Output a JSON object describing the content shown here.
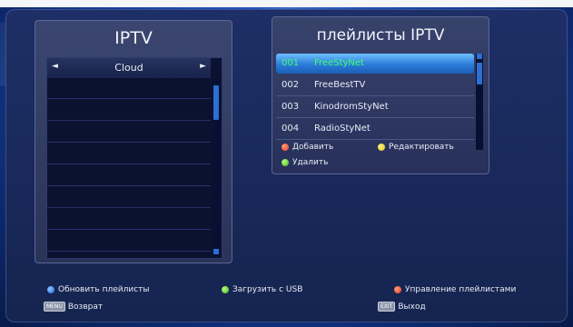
{
  "left_panel": {
    "title": "IPTV",
    "selector": {
      "value": "Cloud",
      "left_arrow": "◄",
      "right_arrow": "►"
    }
  },
  "right_panel": {
    "title": "плейлисты IPTV",
    "playlists": [
      {
        "num": "001",
        "name": "FreeStyNet",
        "selected": true
      },
      {
        "num": "002",
        "name": "FreeBestTV",
        "selected": false
      },
      {
        "num": "003",
        "name": "KinodromStyNet",
        "selected": false
      },
      {
        "num": "004",
        "name": "RadioStyNet",
        "selected": false
      }
    ],
    "actions": {
      "add": "Добавить",
      "edit": "Редактировать",
      "delete": "Удалить"
    }
  },
  "bottom_bar": {
    "refresh": "Обновить плейлисты",
    "load_usb": "Загрузить с USB",
    "manage": "Управление плейлистами",
    "back_key": "MENU",
    "back": "Возврат",
    "exit_key": "EXIT",
    "exit": "Выход"
  },
  "colors": {
    "background": "#1f4fb8",
    "selection": "#2b7cd8",
    "selected_text": "#3cff6a"
  }
}
